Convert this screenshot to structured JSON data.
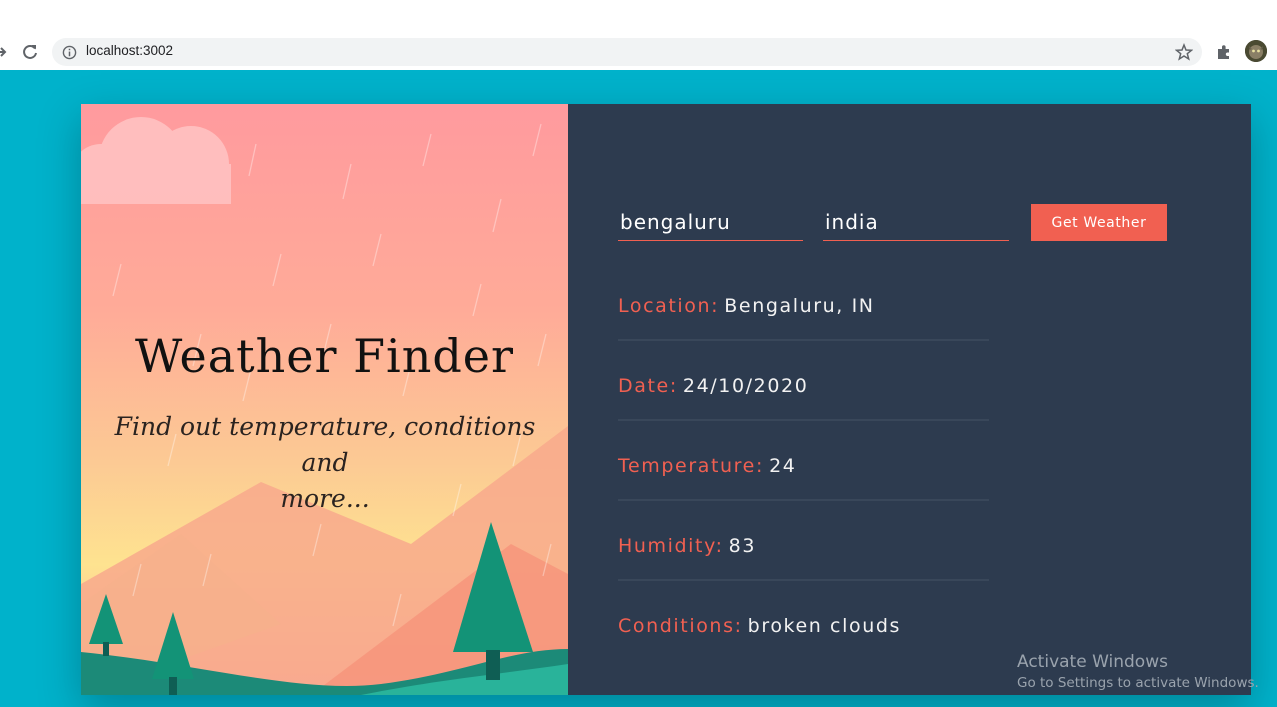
{
  "browser": {
    "url": "localhost:3002",
    "icons": [
      "forward-icon",
      "reload-icon",
      "info-icon",
      "star-icon",
      "extensions-icon",
      "profile-avatar"
    ]
  },
  "hero": {
    "title": "Weather Finder",
    "subtitle_line1": "Find out temperature, conditions and",
    "subtitle_line2": "more..."
  },
  "form": {
    "city_value": "bengaluru",
    "country_value": "india",
    "button_label": "Get Weather"
  },
  "results": [
    {
      "label": "Location:",
      "value": "Bengaluru, IN"
    },
    {
      "label": "Date:",
      "value": "24/10/2020"
    },
    {
      "label": "Temperature:",
      "value": "24"
    },
    {
      "label": "Humidity:",
      "value": "83"
    },
    {
      "label": "Conditions:",
      "value": "broken clouds"
    }
  ],
  "watermark": {
    "line1": "Activate Windows",
    "line2": "Go to Settings to activate Windows."
  },
  "colors": {
    "page_bg": "#00b2cb",
    "panel_bg": "#2d3b4f",
    "accent": "#f16051"
  }
}
